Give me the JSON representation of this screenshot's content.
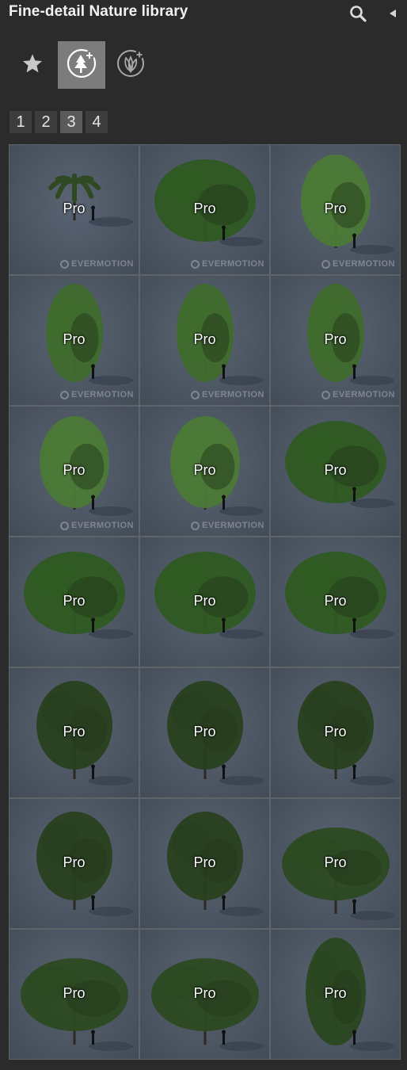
{
  "header": {
    "title": "Fine-detail Nature library",
    "search_icon": "search-icon",
    "collapse_icon": "triangle-left-icon"
  },
  "categories": [
    {
      "name": "favorites",
      "icon": "star-icon",
      "active": false
    },
    {
      "name": "trees",
      "icon": "tree-plus-icon",
      "active": true
    },
    {
      "name": "plants",
      "icon": "leaf-plus-icon",
      "active": false
    }
  ],
  "pagination": {
    "pages": [
      "1",
      "2",
      "3",
      "4"
    ],
    "current": "3"
  },
  "tiles": [
    {
      "badge": "Pro",
      "watermark": "EVERMOTION",
      "kind": "palm"
    },
    {
      "badge": "Pro",
      "watermark": "EVERMOTION",
      "kind": "broad"
    },
    {
      "badge": "Pro",
      "watermark": "EVERMOTION",
      "kind": "light"
    },
    {
      "badge": "Pro",
      "watermark": "EVERMOTION",
      "kind": "slim"
    },
    {
      "badge": "Pro",
      "watermark": "EVERMOTION",
      "kind": "slim"
    },
    {
      "badge": "Pro",
      "watermark": "EVERMOTION",
      "kind": "slim"
    },
    {
      "badge": "Pro",
      "watermark": "EVERMOTION",
      "kind": "light"
    },
    {
      "badge": "Pro",
      "watermark": "EVERMOTION",
      "kind": "light"
    },
    {
      "badge": "Pro",
      "watermark": "",
      "kind": "broad"
    },
    {
      "badge": "Pro",
      "watermark": "",
      "kind": "broad"
    },
    {
      "badge": "Pro",
      "watermark": "",
      "kind": "broad"
    },
    {
      "badge": "Pro",
      "watermark": "",
      "kind": "broad"
    },
    {
      "badge": "Pro",
      "watermark": "",
      "kind": "dark"
    },
    {
      "badge": "Pro",
      "watermark": "",
      "kind": "dark"
    },
    {
      "badge": "Pro",
      "watermark": "",
      "kind": "dark"
    },
    {
      "badge": "Pro",
      "watermark": "",
      "kind": "dark"
    },
    {
      "badge": "Pro",
      "watermark": "",
      "kind": "dark"
    },
    {
      "badge": "Pro",
      "watermark": "",
      "kind": "spread"
    },
    {
      "badge": "Pro",
      "watermark": "",
      "kind": "spread"
    },
    {
      "badge": "Pro",
      "watermark": "",
      "kind": "spread"
    },
    {
      "badge": "Pro",
      "watermark": "",
      "kind": "oval"
    }
  ],
  "colors": {
    "panel_bg": "#2b2b2b",
    "active_category_bg": "#7c7c7c",
    "tile_bg": "#4d5663",
    "foliage": "#3f6b2c"
  }
}
